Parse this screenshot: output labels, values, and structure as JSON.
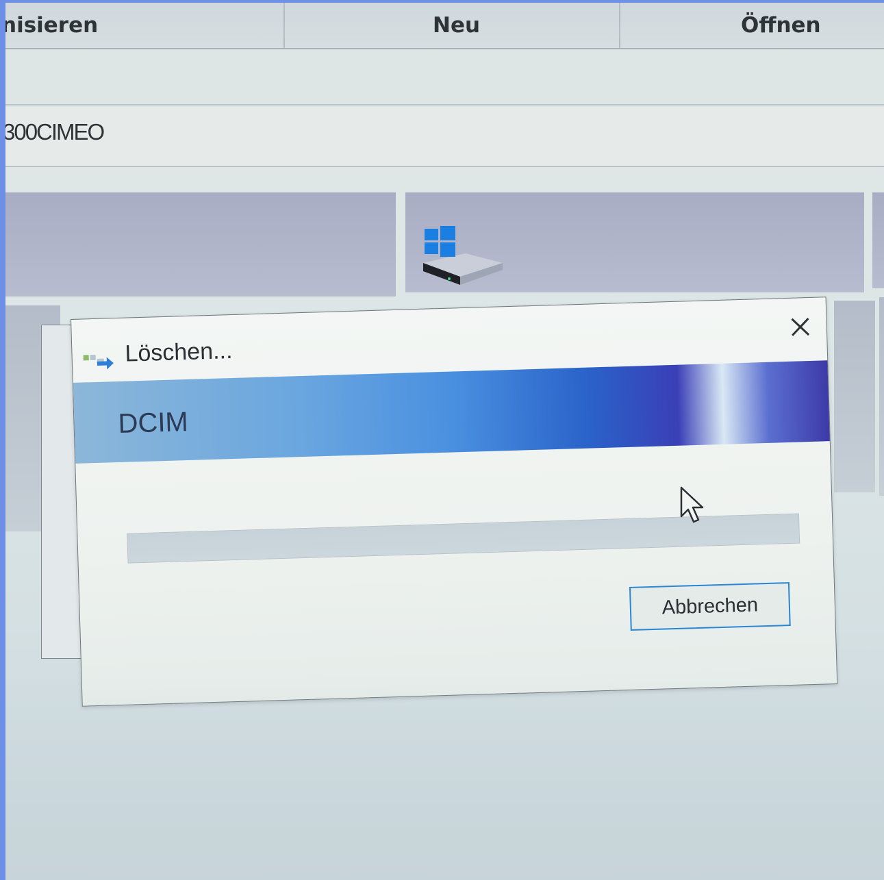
{
  "ribbon": {
    "items": [
      {
        "label": "nisieren"
      },
      {
        "label": "Neu"
      },
      {
        "label": "Öffnen"
      }
    ]
  },
  "address": {
    "text": "300CIMEO"
  },
  "tiles": {
    "drive_icon": "windows-drive-icon"
  },
  "dialog": {
    "title": "Löschen...",
    "title_icon": "move-files-icon",
    "close_icon": "close-icon",
    "banner_text": "DCIM",
    "progress_percent": 0,
    "cancel_label": "Abbrechen",
    "accent": "#2b86d4"
  }
}
